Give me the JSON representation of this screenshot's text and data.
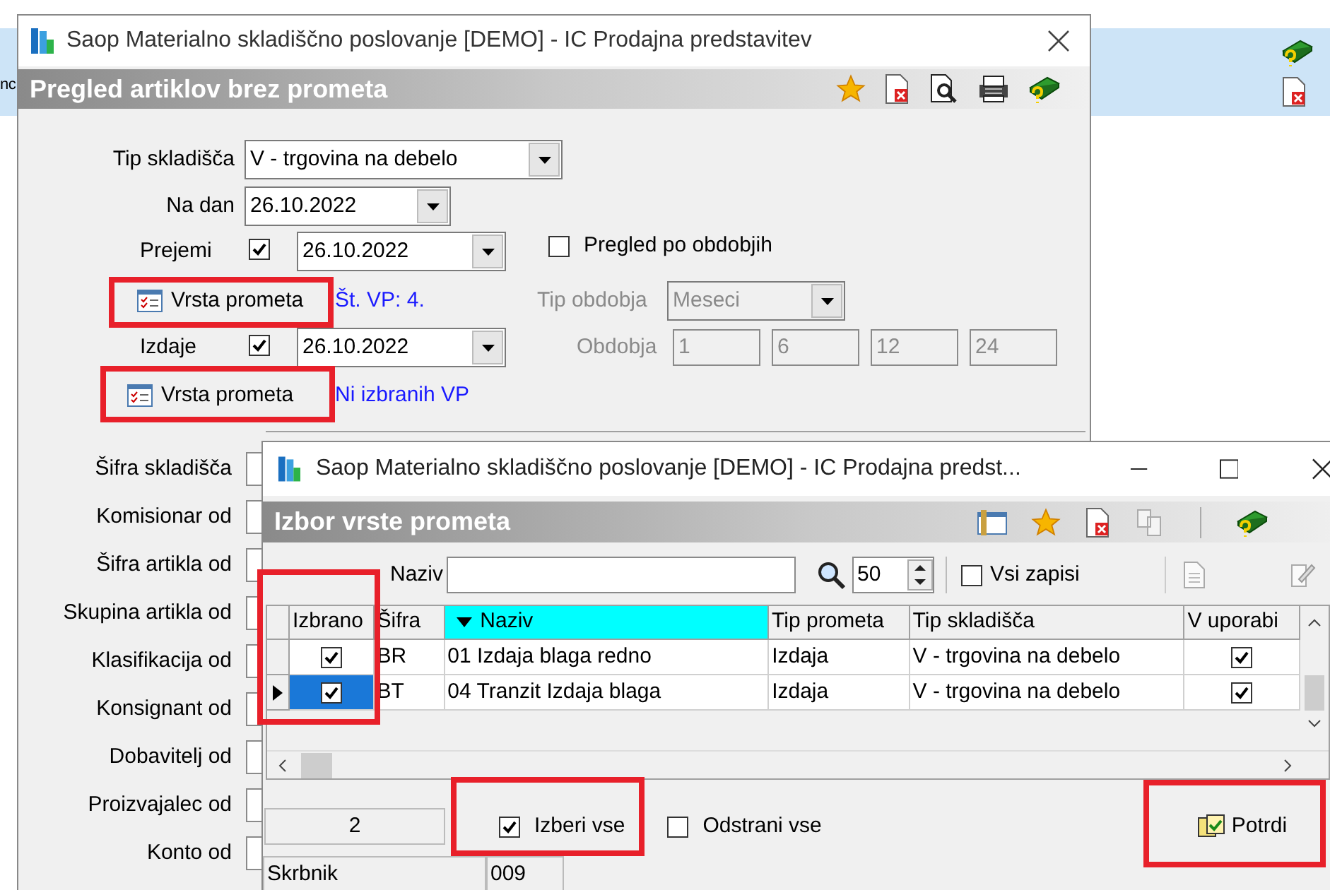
{
  "background": {
    "cut_text": "nc"
  },
  "main_window": {
    "title": "Saop Materialno skladiščno poslovanje [DEMO] - IC Prodajna predstavitev",
    "header": "Pregled artiklov brez prometa",
    "tip_skladisca": {
      "label": "Tip skladišča",
      "value": "V - trgovina na debelo"
    },
    "na_dan": {
      "label": "Na dan",
      "value": "26.10.2022"
    },
    "prejemi": {
      "label": "Prejemi",
      "checked": true,
      "date": "26.10.2022",
      "button": "Vrsta prometa",
      "info": "Št. VP: 4."
    },
    "pregled_po_obdobjih": {
      "label": "Pregled po obdobjih",
      "checked": false
    },
    "tip_obdobja": {
      "label": "Tip obdobja",
      "value": "Meseci",
      "disabled": true
    },
    "izdaje": {
      "label": "Izdaje",
      "checked": true,
      "date": "26.10.2022",
      "button": "Vrsta prometa",
      "info": "Ni izbranih VP"
    },
    "obdobja": {
      "label": "Obdobja",
      "disabled": true,
      "values": [
        "1",
        "6",
        "12",
        "24"
      ]
    },
    "filter_labels": [
      "Šifra skladišča",
      "Komisionar od",
      "Šifra artikla od",
      "Skupina artikla od",
      "Klasifikacija od",
      "Konsignant od",
      "Dobavitelj od",
      "Proizvajalec od",
      "Konto od"
    ]
  },
  "dialog": {
    "title": "Saop Materialno skladiščno poslovanje [DEMO] - IC Prodajna predst...",
    "header": "Izbor vrste prometa",
    "search_label": "Naziv",
    "page_size": "50",
    "vsi_zapisi": {
      "label": "Vsi zapisi",
      "checked": false
    },
    "columns": [
      {
        "label": "Izbrano",
        "sorted": false
      },
      {
        "label": "Šifra",
        "sorted": false
      },
      {
        "label": "Naziv",
        "sorted": true
      },
      {
        "label": "Tip prometa",
        "sorted": false
      },
      {
        "label": "Tip skladišča",
        "sorted": false
      },
      {
        "label": "V uporabi",
        "sorted": false
      }
    ],
    "rows": [
      {
        "izbrano": true,
        "sifra": "BR",
        "naziv": "01 Izdaja blaga redno",
        "tip_prometa": "Izdaja",
        "tip_skladisca": "V - trgovina na debelo",
        "v_uporabi": true,
        "selected": false
      },
      {
        "izbrano": true,
        "sifra": "BT",
        "naziv": "04 Tranzit Izdaja blaga",
        "tip_prometa": "Izdaja",
        "tip_skladisca": "V - trgovina na debelo",
        "v_uporabi": true,
        "selected": true
      }
    ],
    "count": "2",
    "izberi_vse": {
      "label": "Izberi vse",
      "checked": true
    },
    "odstrani_vse": {
      "label": "Odstrani vse",
      "checked": false
    },
    "confirm": "Potrdi",
    "status": [
      "Skrbnik",
      "009"
    ]
  }
}
